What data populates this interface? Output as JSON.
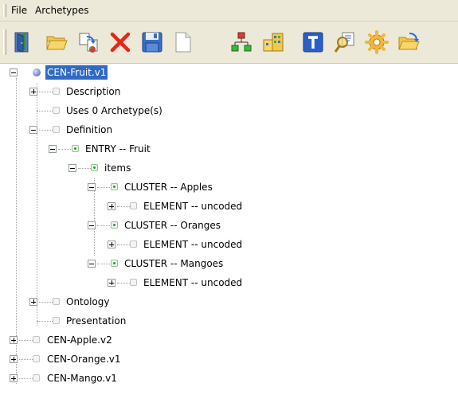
{
  "menu": {
    "file": "File",
    "archetypes": "Archetypes"
  },
  "toolbar": {
    "buttons": [
      {
        "icon": "door-icon"
      },
      {
        "icon": "open-folder-icon"
      },
      {
        "icon": "import-icon"
      },
      {
        "icon": "delete-icon"
      },
      {
        "icon": "save-icon"
      },
      {
        "icon": "new-document-icon"
      },
      {
        "icon": "tree-structure-icon"
      },
      {
        "icon": "database-icon"
      },
      {
        "icon": "text-icon"
      },
      {
        "icon": "search-text-icon"
      },
      {
        "icon": "settings-gear-icon"
      },
      {
        "icon": "open-file-icon"
      }
    ]
  },
  "colors": {
    "selection": "#316ac5",
    "toolbar_bg": "#ece9d8",
    "delete_red": "#e8241a",
    "tree_green": "#2e9b2e"
  },
  "tree": {
    "root": "CEN-Fruit.v1",
    "description": "Description",
    "uses": "Uses 0 Archetype(s)",
    "definition": "Definition",
    "entry": "ENTRY -- Fruit",
    "items": "items",
    "cluster_apples": "CLUSTER -- Apples",
    "element_1": "ELEMENT -- uncoded",
    "cluster_oranges": "CLUSTER -- Oranges",
    "element_2": "ELEMENT -- uncoded",
    "cluster_mangoes": "CLUSTER -- Mangoes",
    "element_3": "ELEMENT -- uncoded",
    "ontology": "Ontology",
    "presentation": "Presentation",
    "apple": "CEN-Apple.v2",
    "orange": "CEN-Orange.v1",
    "mango": "CEN-Mango.v1"
  }
}
